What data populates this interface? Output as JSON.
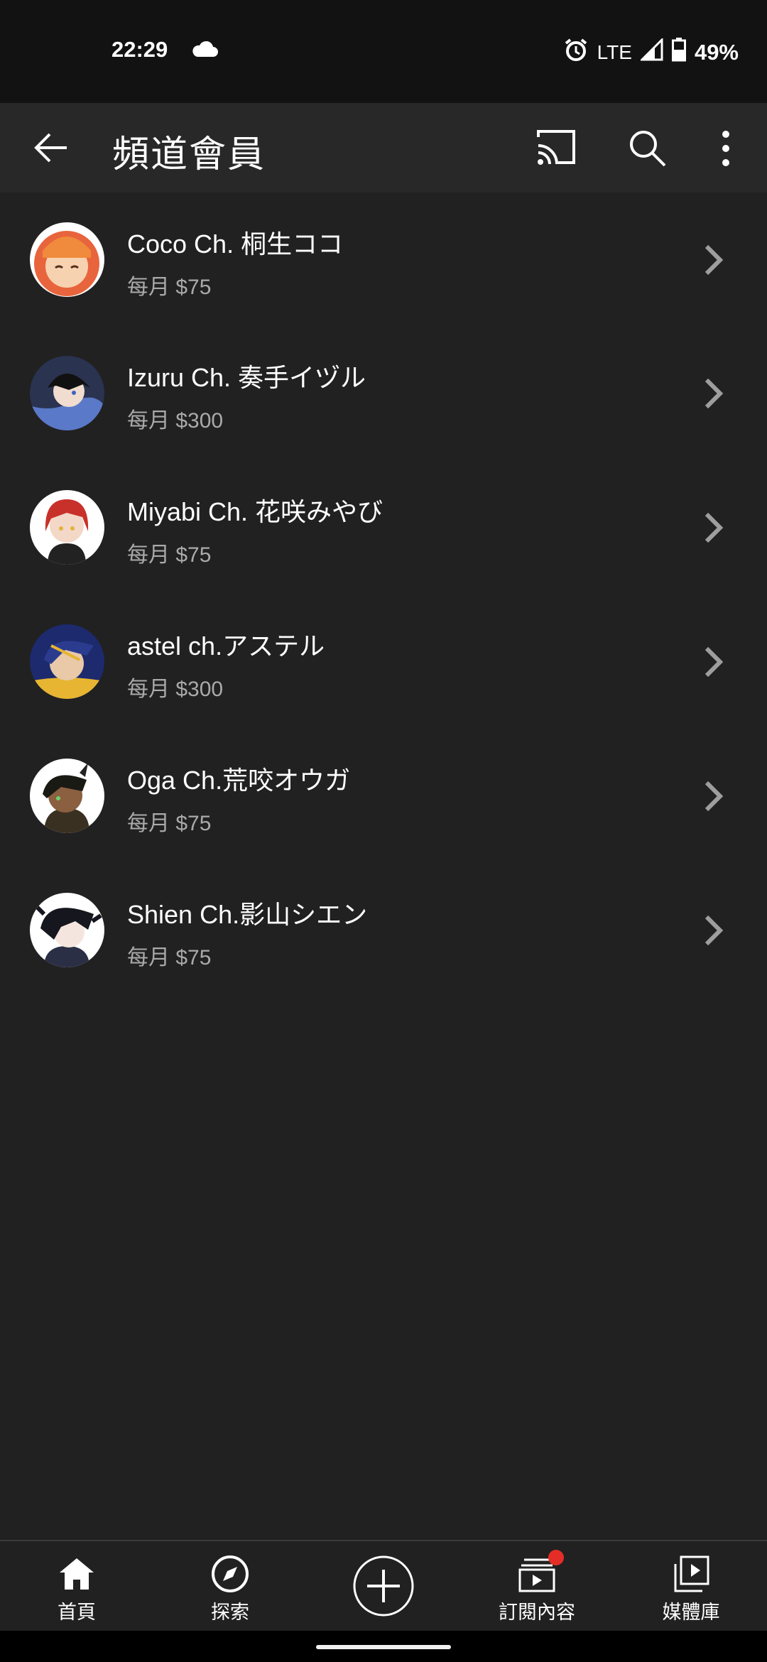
{
  "status_bar": {
    "time": "22:29",
    "network": "LTE",
    "battery": "49%"
  },
  "app_bar": {
    "title": "頻道會員"
  },
  "members": [
    {
      "name": "Coco Ch. 桐生ココ",
      "price": "每月 $75",
      "avatar_colors": [
        "#f7b06a",
        "#e8643c"
      ]
    },
    {
      "name": "Izuru Ch. 奏手イヅル",
      "price": "每月 $300",
      "avatar_colors": [
        "#3b4a7a",
        "#1a1e2e"
      ]
    },
    {
      "name": "Miyabi Ch. 花咲みやび",
      "price": "每月 $75",
      "avatar_colors": [
        "#ffffff",
        "#c8312a"
      ]
    },
    {
      "name": "astel ch.アステル",
      "price": "每月 $300",
      "avatar_colors": [
        "#2b3c8f",
        "#e7b531"
      ]
    },
    {
      "name": "Oga Ch.荒咬オウガ",
      "price": "每月 $75",
      "avatar_colors": [
        "#ffffff",
        "#3a3022"
      ]
    },
    {
      "name": "Shien Ch.影山シエン",
      "price": "每月 $75",
      "avatar_colors": [
        "#ffffff",
        "#2a2f45"
      ]
    }
  ],
  "bottom_nav": {
    "home": "首頁",
    "explore": "探索",
    "subscriptions": "訂閱內容",
    "library": "媒體庫"
  },
  "colors": {
    "background": "#212121",
    "app_bar": "#282828",
    "status_bar": "#121212",
    "secondary_text": "#aaaaaa",
    "notification": "#e52d27"
  },
  "icons": {
    "back": "arrow-left-icon",
    "cast": "cast-icon",
    "search": "search-icon",
    "more": "more-vert-icon",
    "chevron": "chevron-right-icon",
    "home": "home-icon",
    "explore": "compass-icon",
    "create": "plus-circle-icon",
    "subscriptions": "subscriptions-icon",
    "library": "library-icon"
  }
}
